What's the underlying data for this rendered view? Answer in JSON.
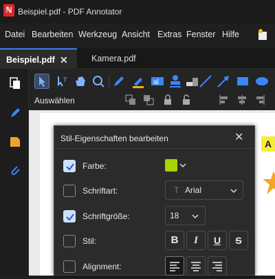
{
  "app": {
    "title": "Beispiel.pdf - PDF Annotator"
  },
  "menu": [
    "Datei",
    "Bearbeiten",
    "Werkzeug",
    "Ansicht",
    "Extras",
    "Fenster",
    "Hilfe"
  ],
  "tabs": {
    "active": "Beispiel.pdf",
    "active_close": "✕",
    "other": "Kamera.pdf"
  },
  "toolbar": {
    "mode_label": "Auswählen"
  },
  "colors": {
    "accent": "#3d7ef0",
    "swatch": "#a8d400",
    "sidebar_blue": "#3a86ff",
    "sidebar_orange": "#f0a030",
    "annotation_yellow": "#f6ec3a",
    "star": "#f5a623"
  },
  "dialog": {
    "title": "Stil-Eigenschaften bearbeiten",
    "close": "✕",
    "rows": [
      {
        "label": "Farbe:",
        "checked": true
      },
      {
        "label": "Schriftart:",
        "checked": false,
        "value": "Arial"
      },
      {
        "label": "Schriftgröße:",
        "checked": true,
        "value": "18"
      },
      {
        "label": "Stil:",
        "checked": false,
        "buttons": [
          "B",
          "I",
          "U",
          "S"
        ]
      },
      {
        "label": "Alignment:",
        "checked": false,
        "selected": "left"
      }
    ]
  },
  "page": {
    "annotation_letter": "A"
  }
}
